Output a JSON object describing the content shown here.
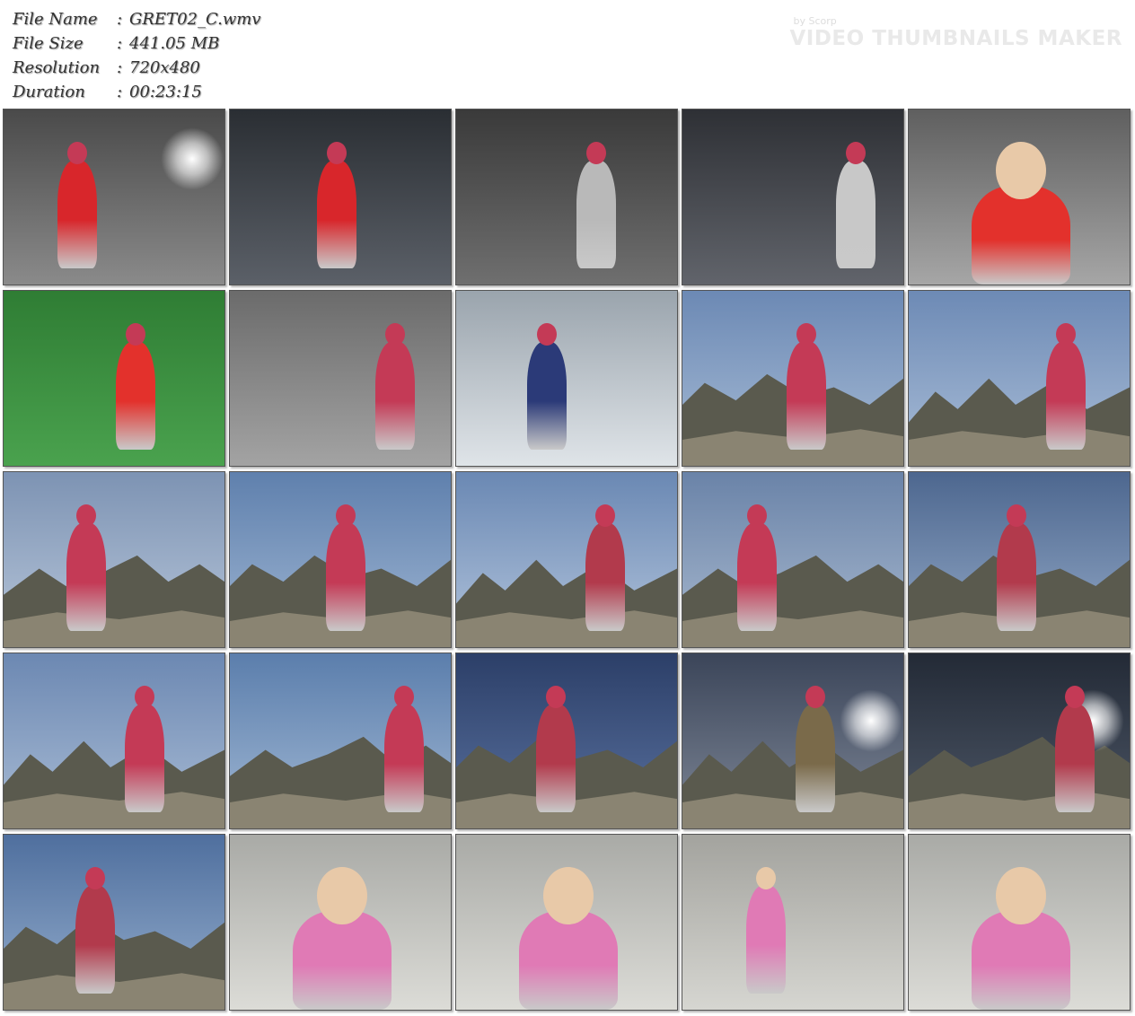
{
  "info": {
    "rows": [
      {
        "label": "File Name",
        "sep": ":",
        "value": "GRET02_C.wmv"
      },
      {
        "label": "File Size",
        "sep": ":",
        "value": "441.05 MB"
      },
      {
        "label": "Resolution",
        "sep": ":",
        "value": "720x480"
      },
      {
        "label": "Duration",
        "sep": ":",
        "value": "00:23:15"
      }
    ]
  },
  "watermark": {
    "by": "by Scorp",
    "title": "VIDEO THUMBNAILS MAKER"
  },
  "thumbnails": [
    {
      "scene": "red-heroine-bound-industrial",
      "bg": [
        "#4a4a4a",
        "#8a8a8a"
      ],
      "accent": "#d8262b"
    },
    {
      "scene": "red-suit-closeup-lights",
      "bg": [
        "#2a2e33",
        "#5b6068"
      ],
      "accent": "#d8262b"
    },
    {
      "scene": "silver-costume-crew",
      "bg": [
        "#3a3a3a",
        "#6f6f6f"
      ],
      "accent": "#b9b9b9"
    },
    {
      "scene": "silver-hero-grabs-heroine",
      "bg": [
        "#2e3035",
        "#61646b"
      ],
      "accent": "#c8c8c8"
    },
    {
      "scene": "heroine-smiling-portrait",
      "bg": [
        "#5f5f5f",
        "#a6a6a6"
      ],
      "accent": "#e3312c"
    },
    {
      "scene": "green-screen-heroine",
      "bg": [
        "#2f7d34",
        "#4aa24e"
      ],
      "accent": "#e3312c"
    },
    {
      "scene": "pink-hero-shutter",
      "bg": [
        "#6b6b6b",
        "#a3a3a3"
      ],
      "accent": "#c43a56"
    },
    {
      "scene": "heroine-seated-rooftop",
      "bg": [
        "#9aa4ad",
        "#dfe4e8"
      ],
      "accent": "#2b3a78"
    },
    {
      "scene": "pink-hero-masked-man",
      "bg": [
        "#6c89b4",
        "#a7bcd6"
      ],
      "accent": "#c43a56"
    },
    {
      "scene": "hero-on-rocks-wide",
      "bg": [
        "#6d8ab5",
        "#a9bdd7"
      ],
      "accent": "#c43a56"
    },
    {
      "scene": "hero-rocks-building",
      "bg": [
        "#7d93b3",
        "#b7c6da"
      ],
      "accent": "#c43a56"
    },
    {
      "scene": "pink-hero-back-view",
      "bg": [
        "#5f80ad",
        "#9fb6d3"
      ],
      "accent": "#c43a56"
    },
    {
      "scene": "hero-low-angle-sky",
      "bg": [
        "#6a88b3",
        "#b2c4dc"
      ],
      "accent": "#b23a4c"
    },
    {
      "scene": "hero-fallen-monster",
      "bg": [
        "#6a83a8",
        "#a8b9cf"
      ],
      "accent": "#c43a56"
    },
    {
      "scene": "monster-vs-hero",
      "bg": [
        "#4d678f",
        "#93a9c7"
      ],
      "accent": "#b23a4c"
    },
    {
      "scene": "hero-lying-rocks",
      "bg": [
        "#6c88b2",
        "#a9bcd5"
      ],
      "accent": "#c43a56"
    },
    {
      "scene": "masked-man-and-hero",
      "bg": [
        "#5b7eac",
        "#a1b8d4"
      ],
      "accent": "#c43a56"
    },
    {
      "scene": "hero-crucified-camera",
      "bg": [
        "#2c3f68",
        "#5a72a0"
      ],
      "accent": "#b23a4c"
    },
    {
      "scene": "monster-tail-night",
      "bg": [
        "#3b4559",
        "#7e8797"
      ],
      "accent": "#7a6a4a"
    },
    {
      "scene": "monster-sword-hero",
      "bg": [
        "#232a36",
        "#4e5868"
      ],
      "accent": "#b23a4c"
    },
    {
      "scene": "monster-crew-sky",
      "bg": [
        "#4f6f9e",
        "#95aecd"
      ],
      "accent": "#b23a4c"
    },
    {
      "scene": "robe-woman-locker-1",
      "bg": [
        "#a9aaa6",
        "#dcdcd7"
      ],
      "accent": "#e07ab5"
    },
    {
      "scene": "robe-woman-locker-2",
      "bg": [
        "#a9aaa6",
        "#dcdcd7"
      ],
      "accent": "#e07ab5"
    },
    {
      "scene": "locker-room-helmet",
      "bg": [
        "#a3a39e",
        "#d6d6d1"
      ],
      "accent": "#e07ab5"
    },
    {
      "scene": "robe-woman-locker-3",
      "bg": [
        "#a9aaa6",
        "#dcdcd7"
      ],
      "accent": "#e07ab5"
    }
  ]
}
